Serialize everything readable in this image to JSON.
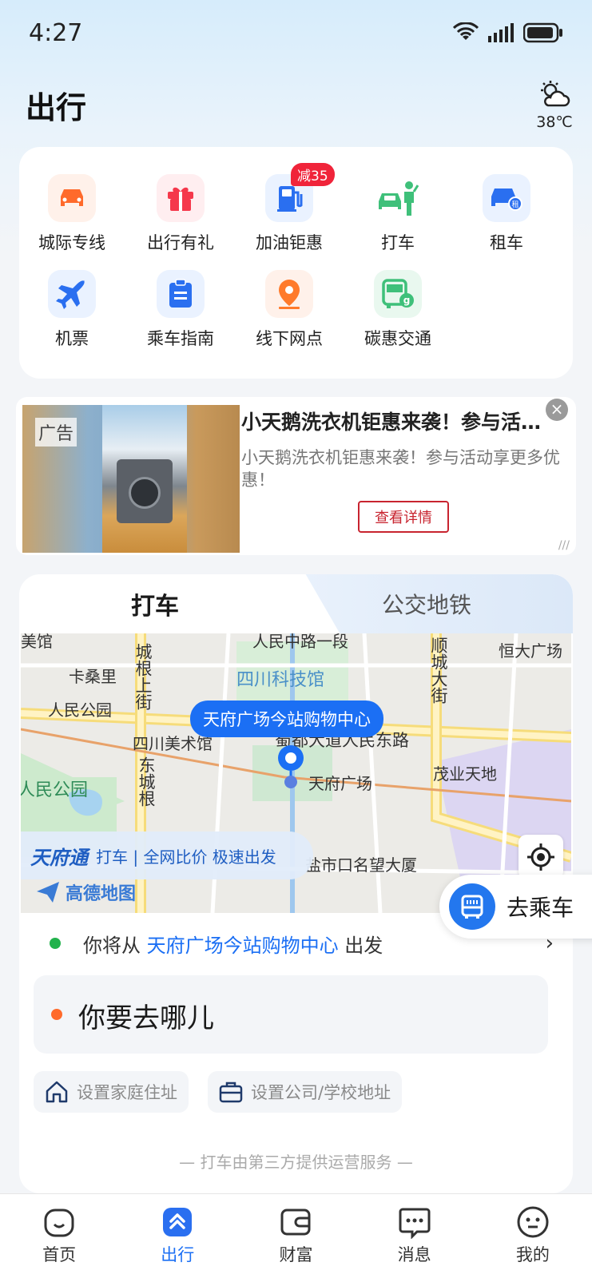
{
  "status_bar": {
    "time": "4:27"
  },
  "header": {
    "title": "出行",
    "weather_temp": "38℃"
  },
  "services": [
    {
      "label": "城际专线",
      "icon": "car-icon",
      "color": "#ff6a2b",
      "bg": "#fff1ea"
    },
    {
      "label": "出行有礼",
      "icon": "gift-icon",
      "color": "#f5384b",
      "bg": "#ffeef0"
    },
    {
      "label": "加油钜惠",
      "icon": "gas-station-icon",
      "color": "#2a6ff0",
      "bg": "#eaf2ff",
      "badge": "减35"
    },
    {
      "label": "打车",
      "icon": "taxi-hail-icon",
      "color": "#3fc07a",
      "bg": "#ffffff"
    },
    {
      "label": "租车",
      "icon": "car-rental-icon",
      "color": "#2a6ff0",
      "bg": "#eaf2ff"
    },
    {
      "label": "机票",
      "icon": "plane-icon",
      "color": "#2a6ff0",
      "bg": "#eaf2ff"
    },
    {
      "label": "乘车指南",
      "icon": "clipboard-icon",
      "color": "#2a6ff0",
      "bg": "#eaf2ff"
    },
    {
      "label": "线下网点",
      "icon": "location-pin-icon",
      "color": "#ff7a2b",
      "bg": "#fff1ea"
    },
    {
      "label": "碳惠交通",
      "icon": "green-bus-icon",
      "color": "#3fc07a",
      "bg": "#e9f8ef"
    }
  ],
  "ad": {
    "tag": "广告",
    "title": "小天鹅洗衣机钜惠来袭！参与活动享更多优惠！",
    "description": "小天鹅洗衣机钜惠来袭！参与活动享更多优惠！",
    "button": "查看详情"
  },
  "ride": {
    "tabs": [
      "打车",
      "公交地铁"
    ],
    "map": {
      "pickup_label": "天府广场今站购物中心",
      "labels": {
        "renmin_zhonglu": "人民中路一段",
        "sichuan_science_museum": "四川科技馆",
        "kasangli": "卡桑里",
        "renmin_park_top": "人民公园",
        "sichuan_art_museum": "四川美术馆",
        "shudu_ave": "蜀都大道人民东路",
        "tianfu_square": "天府广场",
        "maoye": "茂业天地",
        "renmin_park_left": "人民公园",
        "yanshikou": "盐市口名望大厦",
        "hengda": "恒大广场",
        "shuncheng_st": "顺城大街",
        "dongcheng_gen_upper": "城根上街",
        "dongcheng_gen_lower": "东城根",
        "street_tl": "美馆"
      },
      "promo_logo": "天府通",
      "promo_text": "打车 | 全网比价 极速出发",
      "map_brand": "高德地图"
    },
    "go_bus_label": "去乘车",
    "from_prefix": "你将从",
    "from_location": "天府广场今站购物中心",
    "from_suffix": "出发",
    "destination_placeholder": "你要去哪儿",
    "home_shortcut": "设置家庭住址",
    "work_shortcut": "设置公司/学校地址",
    "footnote": "— 打车由第三方提供运营服务 —"
  },
  "bottom_nav": [
    {
      "label": "首页",
      "icon": "home-icon",
      "active": false
    },
    {
      "label": "出行",
      "icon": "travel-icon",
      "active": true
    },
    {
      "label": "财富",
      "icon": "wallet-icon",
      "active": false
    },
    {
      "label": "消息",
      "icon": "message-icon",
      "active": false
    },
    {
      "label": "我的",
      "icon": "profile-icon",
      "active": false
    }
  ]
}
